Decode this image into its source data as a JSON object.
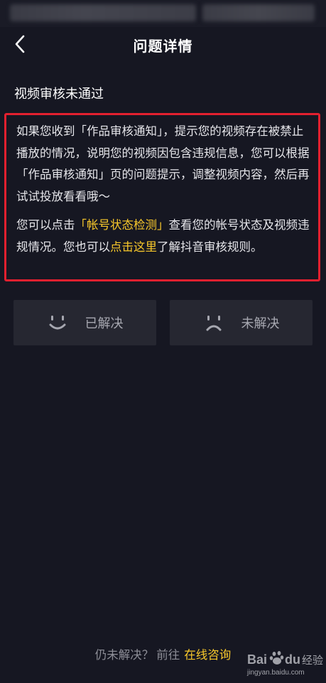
{
  "header": {
    "title": "问题详情"
  },
  "issue": {
    "heading": "视频审核未通过",
    "para1": "如果您收到「作品审核通知」，提示您的视频存在被禁止播放的情况，说明您的视频因包含违规信息，您可以根据「作品审核通知」页的问题提示，调整视频内容，然后再试试投放看看哦～",
    "para2_before": "您可以点击",
    "para2_link1": "「帐号状态检测」",
    "para2_middle": "查看您的帐号状态及视频违规情况。您也可以",
    "para2_link2": "点击这里",
    "para2_after": "了解抖音审核规则。"
  },
  "feedback": {
    "solved_label": "已解决",
    "unsolved_label": "未解决"
  },
  "footer": {
    "prefix": "仍未解决？",
    "goto": "前往",
    "link": "在线咨询"
  },
  "watermark": {
    "brand": "Bai",
    "brand2": "du",
    "label": "经验",
    "url": "jingyan.baidu.com"
  },
  "colors": {
    "background": "#161722",
    "accent": "#f8c82b",
    "highlight_border": "#e3202f",
    "button_bg": "#262731"
  }
}
